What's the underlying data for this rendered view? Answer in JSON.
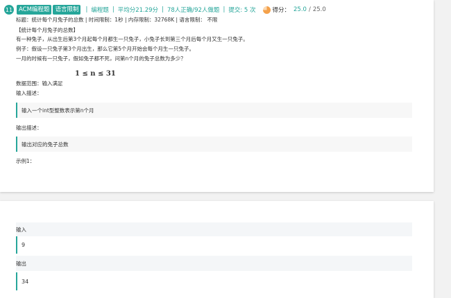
{
  "header": {
    "number": "11",
    "tag_type": "ACM编程题",
    "tag_limit": "语言限制",
    "category": "编程题",
    "avg_score": "平均分21.29分",
    "stats": "78人正确/92人做题",
    "submissions": "提交: 5 次",
    "score_label": "得分：",
    "score": "25.0",
    "score_sep": "/",
    "score_total": "25.0"
  },
  "problem": {
    "title_line": "标题：统计每个月兔子的总数 | 时间限制：1秒 | 内存限制：32768K | 语言限制： 不限",
    "heading": "【统计每个月兔子的总数】",
    "desc1": "有一种兔子，从出生后第3个月起每个月都生一只兔子，小兔子长到第三个月后每个月又生一只兔子。",
    "desc2": "例子：假设一只兔子第3个月出生，那么它第5个月开始会每个月生一只兔子。",
    "desc3": "一月的时候有一只兔子，假如兔子都不死，问第n个月的兔子总数为多少？",
    "formula": "1 ≤ n ≤ 31",
    "range_label": "数据范围：输入满足",
    "input_label": "输入描述：",
    "input_desc": "输入一个int型整数表示第n个月",
    "output_label": "输出描述：",
    "output_desc": "输出对应的兔子总数",
    "example_label": "示例1："
  },
  "example": {
    "input_label": "输入",
    "input_value": "9",
    "output_label": "输出",
    "output_value": "34"
  },
  "colors": {
    "accent": "#26a69a",
    "pie": "#f4a14a"
  }
}
